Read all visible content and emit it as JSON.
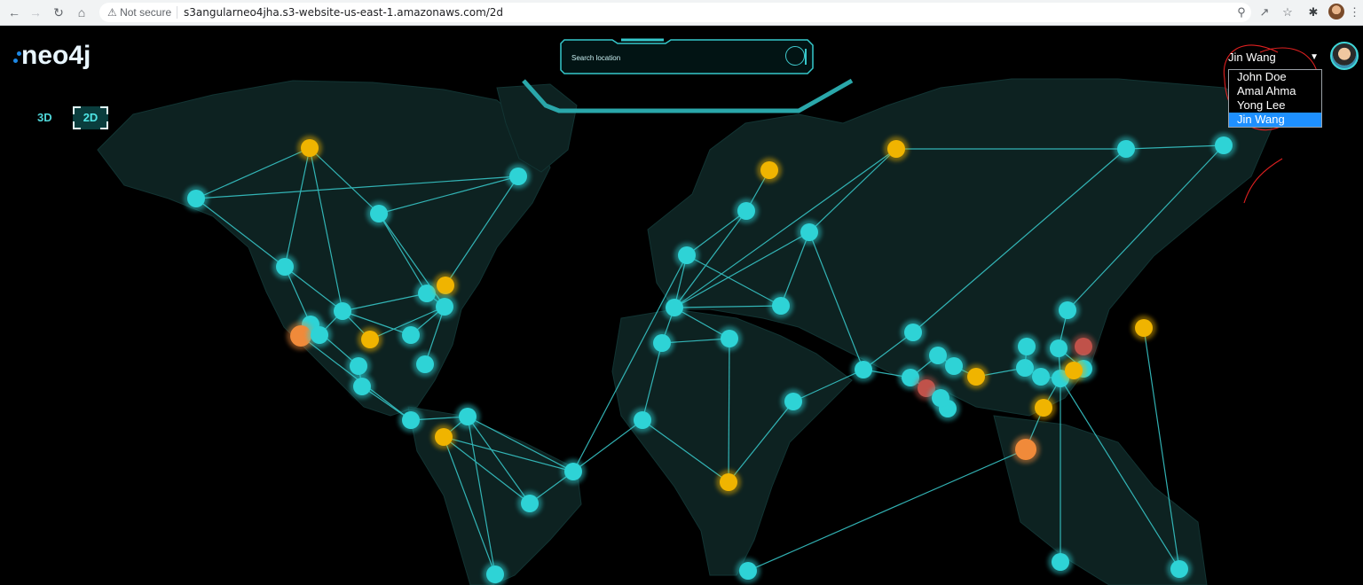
{
  "browser": {
    "security_label": "Not secure",
    "url": "s3angularneo4jha.s3-website-us-east-1.amazonaws.com/2d",
    "icons": [
      "back-icon",
      "forward-icon",
      "reload-icon",
      "home-icon",
      "zoom-icon",
      "share-icon",
      "star-icon",
      "extensions-icon",
      "profile-icon",
      "menu-icon"
    ]
  },
  "app": {
    "logo_text": "neo4j",
    "view_modes": {
      "mode_3d": "3D",
      "mode_2d": "2D",
      "active": "2D"
    },
    "search": {
      "placeholder": "Search location"
    },
    "user": {
      "selected": "Jin Wang",
      "options": [
        "John Doe",
        "Amal Ahma",
        "Yong Lee",
        "Jin Wang"
      ]
    }
  },
  "colors": {
    "land": "#0d2221",
    "node_cyan": "#2ed3d6",
    "node_yellow": "#f0b400",
    "node_orange": "#f08a3a",
    "node_red": "#c0524a",
    "edge": "#37c4c6",
    "annotation": "#e02020"
  }
}
